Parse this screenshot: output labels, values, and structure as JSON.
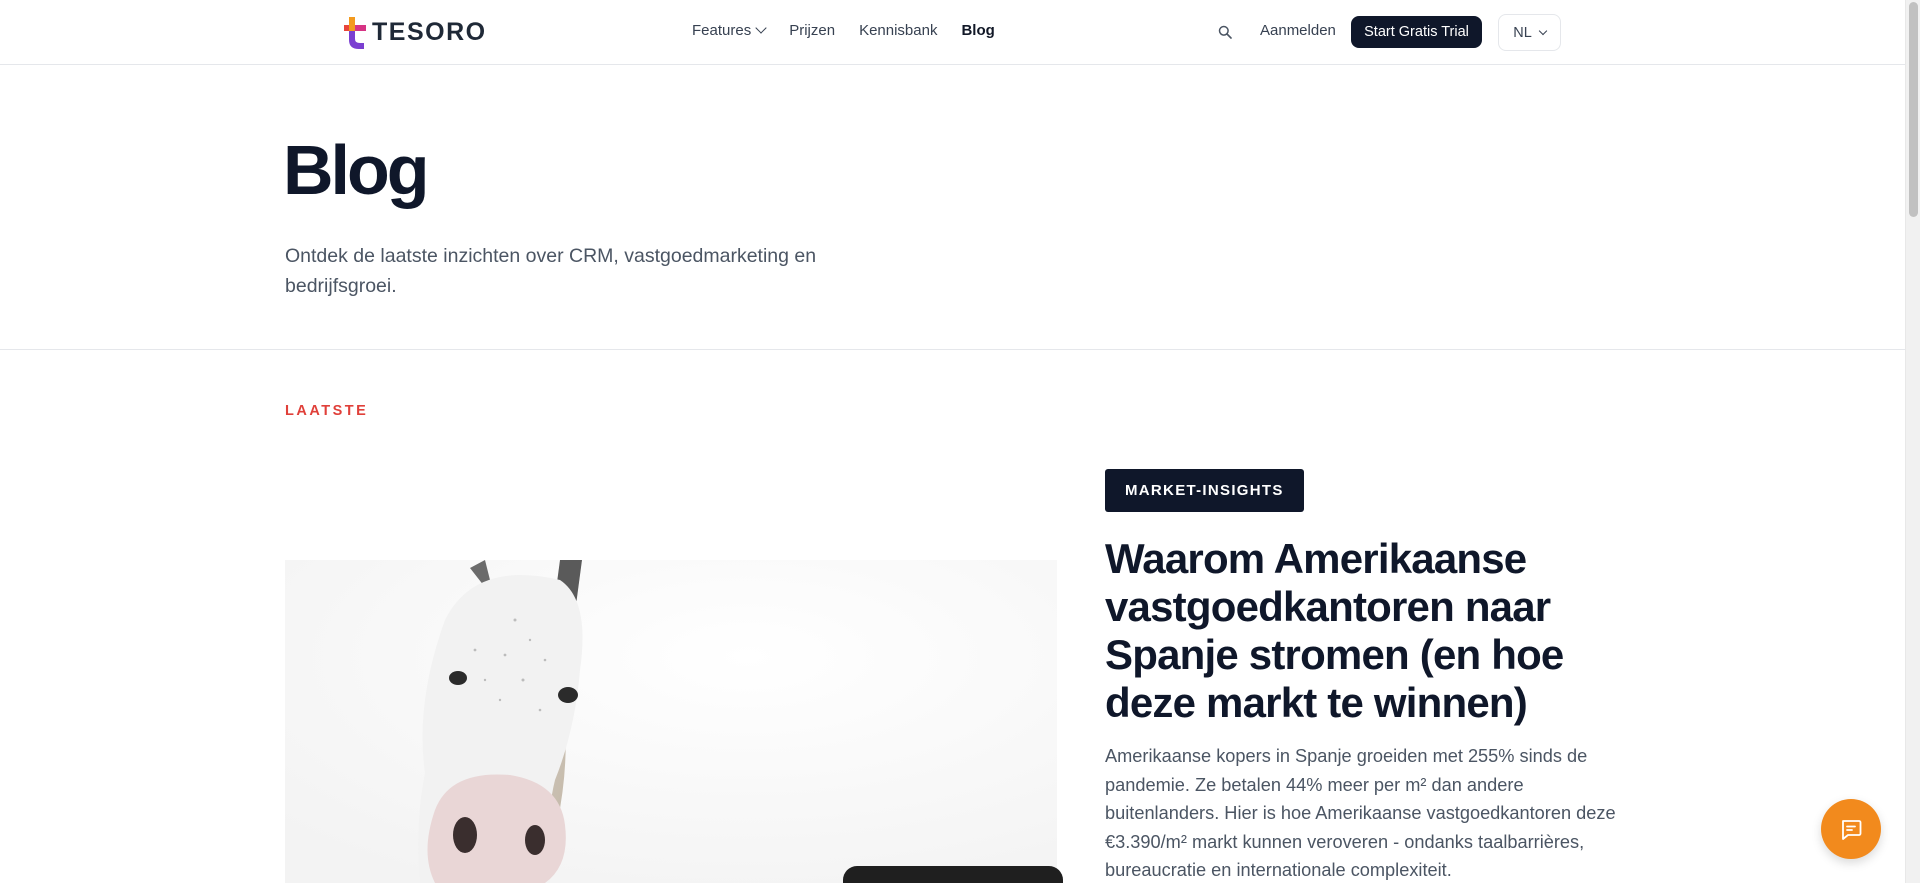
{
  "header": {
    "logo_text": "TESORO",
    "nav": [
      {
        "label": "Features"
      },
      {
        "label": "Prijzen"
      },
      {
        "label": "Kennisbank"
      },
      {
        "label": "Blog"
      }
    ],
    "login_label": "Aanmelden",
    "trial_label": "Start Gratis Trial",
    "language": "NL"
  },
  "hero": {
    "title": "Blog",
    "subtitle": "Ontdek de laatste inzichten over CRM, vastgoedmarketing en bedrijfsgroei."
  },
  "latest": {
    "section_label": "LAATSTE",
    "category": "MARKET-INSIGHTS",
    "title": "Waarom Amerikaanse vastgoedkantoren naar Spanje stromen (en hoe deze markt te winnen)",
    "excerpt": "Amerikaanse kopers in Spanje groeiden met 255% sinds de pandemie. Ze betalen 44% meer per m² dan andere buitenlanders. Hier is hoe Amerikaanse vastgoedkantoren deze €3.390/m² markt kunnen veroveren - ondanks taalbarrières, bureaucratie en internationale complexiteit."
  },
  "colors": {
    "primary_dark": "#0f172a",
    "accent_red": "#e0403a",
    "chat_orange": "#f28a1d"
  },
  "icons": {
    "search": "search-icon",
    "chat": "chat-icon",
    "dropdown": "chevron-down-icon"
  }
}
